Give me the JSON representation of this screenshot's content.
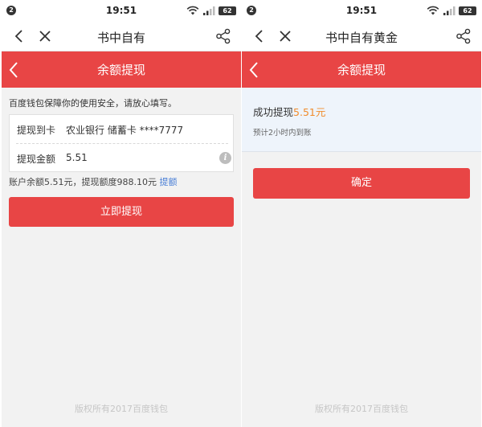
{
  "status_bar": {
    "notification_count": "2",
    "time": "19:51",
    "battery": "62"
  },
  "left": {
    "browser_title": "书中自有",
    "page_title": "余额提现",
    "security_hint": "百度钱包保障你的使用安全，请放心填写。",
    "card_label": "提现到卡",
    "card_value": "农业银行 储蓄卡 ****7777",
    "amount_label": "提现金额",
    "amount_value": "5.51",
    "balance_text": "账户余额5.51元，提现额度988.10元",
    "balance_link": "提额",
    "submit_label": "立即提现",
    "footer": "版权所有2017百度钱包"
  },
  "right": {
    "browser_title": "书中自有黄金",
    "page_title": "余额提现",
    "success_prefix": "成功提现",
    "success_amount": "5.51元",
    "arrival_note": "预计2小时内到账",
    "confirm_label": "确定",
    "footer": "版权所有2017百度钱包"
  },
  "colors": {
    "brand_red": "#e84545",
    "amount_orange": "#f08c2c",
    "link_blue": "#4a7fd6"
  }
}
